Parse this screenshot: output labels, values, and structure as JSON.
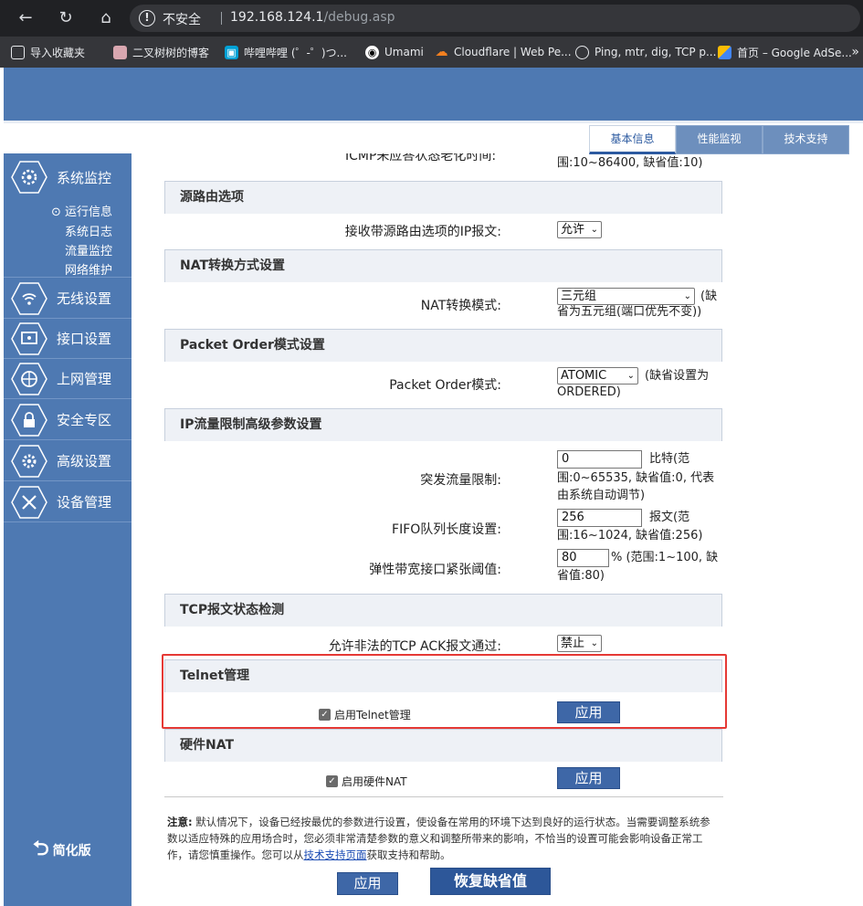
{
  "browser": {
    "insecure_label": "不安全",
    "url_host": "192.168.124.1",
    "url_path": "/debug.asp",
    "bookmarks": [
      {
        "label": "导入收藏夹",
        "icon": "import-icon"
      },
      {
        "label": "二叉树树的博客",
        "icon": "avatar-icon"
      },
      {
        "label": "哔哩哔哩 (゜-゜)つ...",
        "icon": "bilibili-icon"
      },
      {
        "label": "Umami",
        "icon": "umami-icon"
      },
      {
        "label": "Cloudflare | Web Pe...",
        "icon": "cloudflare-icon"
      },
      {
        "label": "Ping, mtr, dig, TCP p...",
        "icon": "globe-icon"
      },
      {
        "label": "首页 – Google AdSe...",
        "icon": "adsense-icon"
      }
    ]
  },
  "top_tabs": [
    {
      "label": "基本信息",
      "active": true
    },
    {
      "label": "性能监视",
      "active": false
    },
    {
      "label": "技术支持",
      "active": false
    }
  ],
  "sidebar": {
    "items": [
      {
        "label": "系统监控",
        "icon": "monitor-icon"
      },
      {
        "label": "无线设置",
        "icon": "wireless-icon"
      },
      {
        "label": "接口设置",
        "icon": "interface-icon"
      },
      {
        "label": "上网管理",
        "icon": "internet-icon"
      },
      {
        "label": "安全专区",
        "icon": "lock-icon"
      },
      {
        "label": "高级设置",
        "icon": "gear-icon"
      },
      {
        "label": "设备管理",
        "icon": "tools-icon"
      }
    ],
    "sub_items": [
      "运行信息",
      "系统日志",
      "流量监控",
      "网络维护"
    ],
    "simple_mode": "简化版"
  },
  "top_partial": {
    "label_fragment": "ICMP未应答状态老化时间:",
    "hint": "围:10~86400, 缺省值:10)"
  },
  "sections": {
    "source_route": {
      "title": "源路由选项",
      "label": "接收带源路由选项的IP报文:",
      "value": "允许"
    },
    "nat": {
      "title": "NAT转换方式设置",
      "label": "NAT转换模式:",
      "value": "三元组",
      "hint_1": "(缺",
      "hint_2": "省为五元组(端口优先不变))"
    },
    "packet_order": {
      "title": "Packet Order模式设置",
      "label": "Packet Order模式:",
      "value": "ATOMIC",
      "hint_1": "(缺省设置为",
      "hint_2": "ORDERED)"
    },
    "ip_limit": {
      "title": "IP流量限制高级参数设置",
      "burst_label": "突发流量限制:",
      "burst_value": "0",
      "burst_hint_1": "比特(范",
      "burst_hint_2": "围:0~65535, 缺省值:0, 代表",
      "burst_hint_3": "由系统自动调节)",
      "fifo_label": "FIFO队列长度设置:",
      "fifo_value": "256",
      "fifo_hint_1": "报文(范",
      "fifo_hint_2": "围:16~1024, 缺省值:256)",
      "elastic_label": "弹性带宽接口紧张阈值:",
      "elastic_value": "80",
      "elastic_hint_1": "% (范围:1~100, 缺",
      "elastic_hint_2": "省值:80)"
    },
    "tcp": {
      "title": "TCP报文状态检测",
      "label": "允许非法的TCP ACK报文通过:",
      "value": "禁止"
    },
    "telnet": {
      "title": "Telnet管理",
      "checkbox_label": "启用Telnet管理",
      "apply": "应用"
    },
    "hw_nat": {
      "title": "硬件NAT",
      "checkbox_label": "启用硬件NAT",
      "apply": "应用"
    }
  },
  "note": {
    "prefix": "注意:",
    "text": "默认情况下，设备已经按最优的参数进行设置，使设备在常用的环境下达到良好的运行状态。当需要调整系统参数以适应特殊的应用场合时，您必须非常清楚参数的意义和调整所带来的影响，不恰当的设置可能会影响设备正常工作，请您慎重操作。您可以从",
    "link": "技术支持页面",
    "suffix": "获取支持和帮助。"
  },
  "footer": {
    "apply": "应用",
    "restore": "恢复缺省值"
  }
}
